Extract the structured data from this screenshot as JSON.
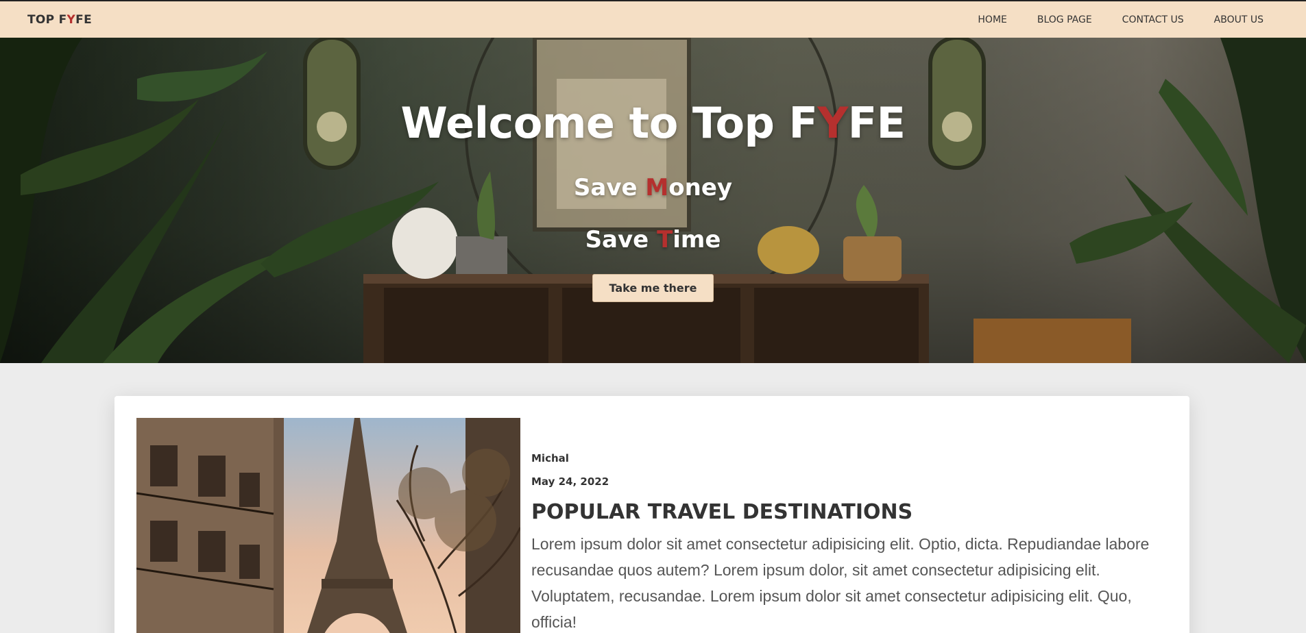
{
  "nav": {
    "logo_prefix": "TOP F",
    "logo_accent": "Y",
    "logo_suffix": "FE",
    "links": [
      "HOME",
      "BLOG PAGE",
      "CONTACT US",
      "ABOUT US"
    ]
  },
  "hero": {
    "title_prefix": "Welcome to Top F",
    "title_accent": "Y",
    "title_suffix": "FE",
    "line1_prefix": "Save ",
    "line1_accent": "M",
    "line1_suffix": "oney",
    "line2_prefix": "Save ",
    "line2_accent": "T",
    "line2_suffix": "ime",
    "button_label": "Take me there"
  },
  "post": {
    "author": "Michal",
    "date": "May 24, 2022",
    "title": "POPULAR TRAVEL DESTINATIONS",
    "body": "Lorem ipsum dolor sit amet consectetur adipisicing elit. Optio, dicta. Repudiandae labore recusandae quos autem? Lorem ipsum dolor, sit amet consectetur adipisicing elit. Voluptatem, recusandae. Lorem ipsum dolor sit amet consectetur adipisicing elit. Quo, officia!"
  },
  "colors": {
    "accent": "#b5302e",
    "nav_bg": "#f5dfc5",
    "page_bg": "#ececec"
  }
}
